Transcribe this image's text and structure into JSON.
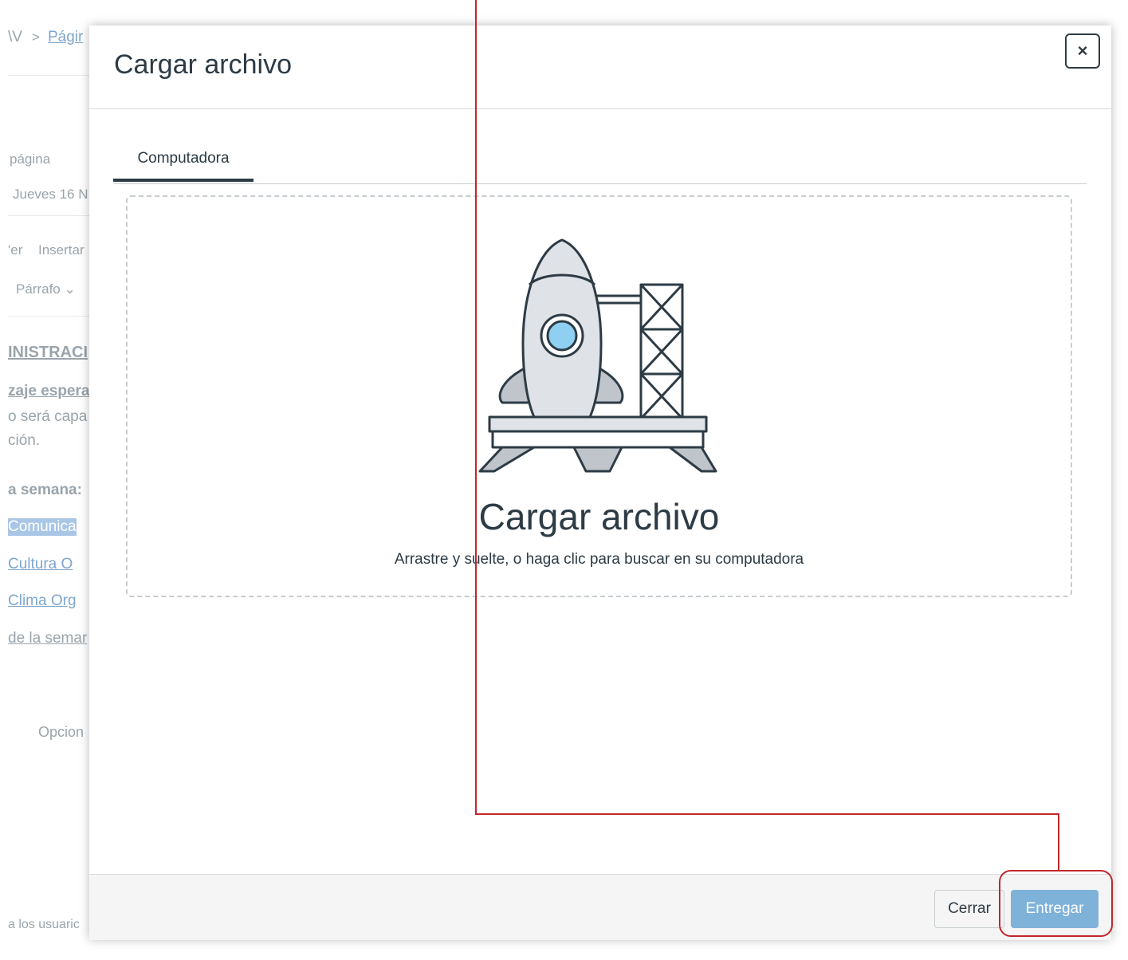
{
  "background_page": {
    "breadcrumb_left": "\\V",
    "breadcrumb_sep": ">",
    "breadcrumb_link": "Págir",
    "field_label": "página",
    "date_value": "Jueves 16 N",
    "menu_ver": "'er",
    "menu_insertar": "Insertar",
    "format_select": "Párrafo ⌄",
    "heading": "INISTRACI",
    "subheading": "zaje espera",
    "text_line1": "o será capa",
    "text_line2": "ción.",
    "bold_line": "a semana:",
    "link_1": "Comunica",
    "link_2": "Cultura O",
    "link_3": "Clima Org",
    "link_4": "de la semar",
    "options_label": "Opcion",
    "footer_note": "a los usuaric"
  },
  "modal": {
    "title": "Cargar archivo",
    "close_label": "×",
    "tabs": [
      {
        "label": "Computadora",
        "active": true
      }
    ],
    "dropzone": {
      "icon": "rocket-launch-icon",
      "title": "Cargar archivo",
      "hint": "Arrastre y suelte, o haga clic para buscar en su computadora"
    },
    "footer": {
      "cancel_label": "Cerrar",
      "submit_label": "Entregar"
    }
  },
  "colors": {
    "text": "#2d3b45",
    "submit_button": "#7fb2d9",
    "annotation": "#c0272d"
  }
}
